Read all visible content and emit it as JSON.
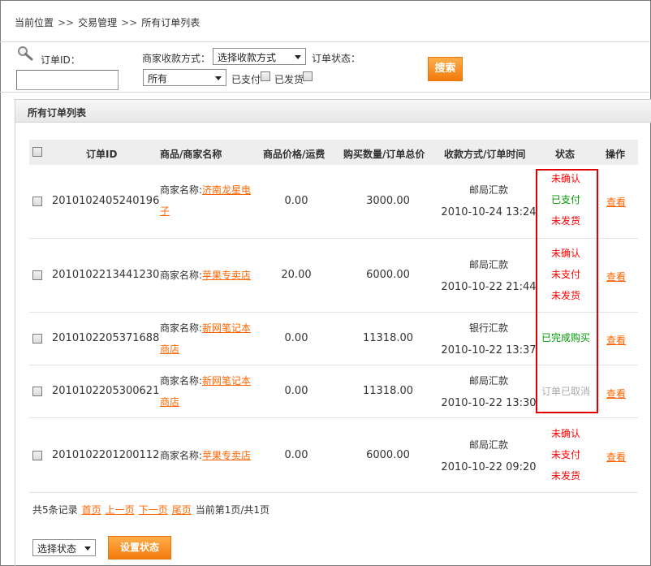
{
  "breadcrumb": {
    "items": [
      "当前位置",
      "交易管理",
      "所有订单列表"
    ],
    "separator": ">>"
  },
  "search": {
    "order_id_label": "订单ID：",
    "order_id_value": "",
    "payment_label": "商家收款方式：",
    "payment_selected": "选择收款方式",
    "status_label": "订单状态：",
    "status_selected": "所有",
    "paid_label": "已支付",
    "shipped_label": "已发货",
    "search_button": "搜索"
  },
  "panel": {
    "title": "所有订单列表"
  },
  "table": {
    "headers": [
      "订单ID",
      "商品/商家名称",
      "商品价格/运费",
      "购买数量/订单总价",
      "收款方式/订单时间",
      "状态",
      "操作"
    ],
    "merchant_prefix": "商家名称:",
    "view_label": "查看",
    "rows": [
      {
        "order_id": "2010102405240196",
        "merchant_l1": "济南龙星电",
        "merchant_l2": "子",
        "price": "0.00",
        "total": "3000.00",
        "pay_method": "邮局汇款",
        "time": "2010-10-24 13:24",
        "status": [
          "未确认",
          "已支付",
          "未发货"
        ]
      },
      {
        "order_id": "2010102213441230",
        "merchant_l1": "苹果专卖店",
        "merchant_l2": "",
        "price": "20.00",
        "total": "6000.00",
        "pay_method": "邮局汇款",
        "time": "2010-10-22 21:44",
        "status": [
          "未确认",
          "未支付",
          "未发货"
        ]
      },
      {
        "order_id": "2010102205371688",
        "merchant_l1": "新网笔记本",
        "merchant_l2": "商店",
        "price": "0.00",
        "total": "11318.00",
        "pay_method": "银行汇款",
        "time": "2010-10-22 13:37",
        "status": [
          "已完成购买"
        ]
      },
      {
        "order_id": "2010102205300621",
        "merchant_l1": "新网笔记本",
        "merchant_l2": "商店",
        "price": "0.00",
        "total": "11318.00",
        "pay_method": "邮局汇款",
        "time": "2010-10-22 13:30",
        "status": [
          "订单已取消"
        ]
      },
      {
        "order_id": "2010102201200112",
        "merchant_l1": "苹果专卖店",
        "merchant_l2": "",
        "price": "0.00",
        "total": "6000.00",
        "pay_method": "邮局汇款",
        "time": "2010-10-22 09:20",
        "status": [
          "未确认",
          "未支付",
          "未发货"
        ]
      }
    ]
  },
  "pager": {
    "records": "共5条记录",
    "first": "首页",
    "prev": "上一页",
    "next": "下一页",
    "last": "尾页",
    "info": "当前第1页/共1页"
  },
  "footer": {
    "status_select": "选择状态",
    "set_button": "设置状态"
  },
  "colors": {
    "accent": "#ff6600",
    "red": "#ff0000",
    "green": "#009900",
    "gray": "#aaaaaa",
    "highlight_border": "#e00000"
  }
}
